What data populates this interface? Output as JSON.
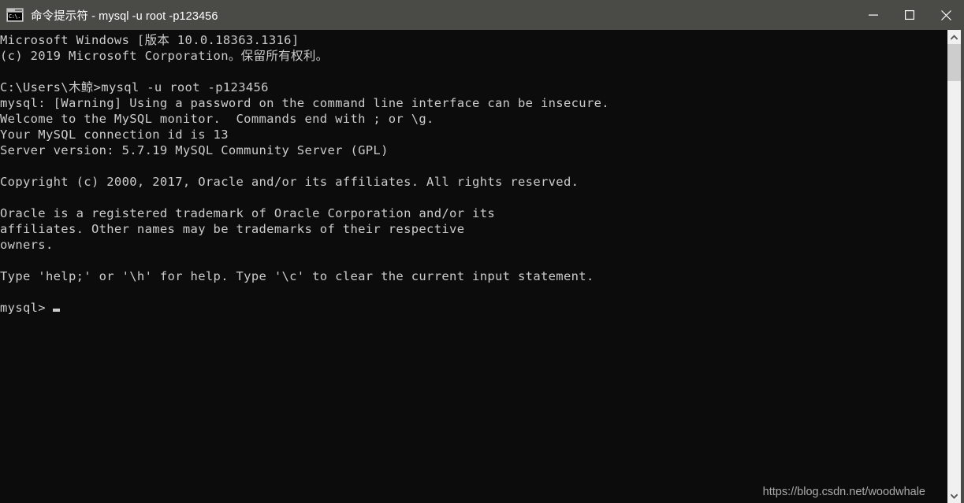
{
  "window": {
    "title": "命令提示符 - mysql  -u root -p123456",
    "icon": "command-prompt-icon",
    "icon_text": "C:\\.",
    "titlebar_color": "#4a4a47",
    "console_bg": "#0c0c0c",
    "console_fg": "#cccccc"
  },
  "controls": {
    "minimize_label": "Minimize",
    "maximize_label": "Maximize",
    "close_label": "Close"
  },
  "console": {
    "lines": [
      "Microsoft Windows [版本 10.0.18363.1316]",
      "(c) 2019 Microsoft Corporation。保留所有权利。",
      "",
      "C:\\Users\\木鲸>mysql -u root -p123456",
      "mysql: [Warning] Using a password on the command line interface can be insecure.",
      "Welcome to the MySQL monitor.  Commands end with ; or \\g.",
      "Your MySQL connection id is 13",
      "Server version: 5.7.19 MySQL Community Server (GPL)",
      "",
      "Copyright (c) 2000, 2017, Oracle and/or its affiliates. All rights reserved.",
      "",
      "Oracle is a registered trademark of Oracle Corporation and/or its",
      "affiliates. Other names may be trademarks of their respective",
      "owners.",
      "",
      "Type 'help;' or '\\h' for help. Type '\\c' to clear the current input statement.",
      ""
    ],
    "prompt": "mysql>",
    "cursor": "block-cursor"
  },
  "watermark": {
    "text": "https://blog.csdn.net/woodwhale"
  },
  "scrollbar": {
    "up_arrow": "chevron-up-icon",
    "down_arrow": "chevron-down-icon",
    "thumb": "scrollbar-thumb"
  }
}
